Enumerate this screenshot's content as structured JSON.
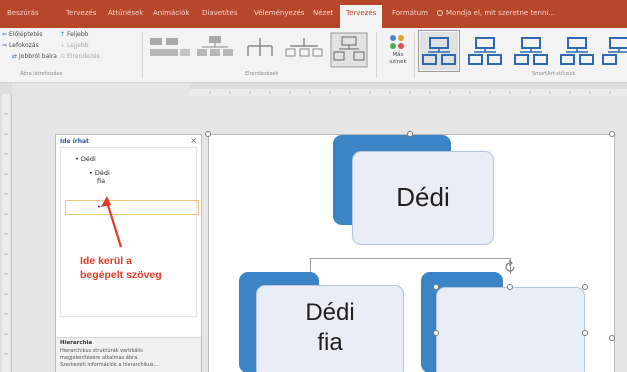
{
  "ribbon_tabs": [
    {
      "label": "Beszúrás"
    },
    {
      "label": "Tervezés"
    },
    {
      "label": "Áttűnések"
    },
    {
      "label": "Animációk"
    },
    {
      "label": "Diavetítés"
    },
    {
      "label": "Véleményezés"
    },
    {
      "label": "Nézet"
    },
    {
      "label": "Tervezés"
    },
    {
      "label": "Formátum"
    }
  ],
  "tell_me": "Mondja el, mit szeretne tenni...",
  "create_group": {
    "items": [
      {
        "label": "Előléptetés",
        "icon": "promote-icon"
      },
      {
        "label": "Lefokozás",
        "icon": "demote-icon"
      },
      {
        "label": "Jobbról balra",
        "icon": "right-to-left-icon"
      },
      {
        "label": "Feljebb",
        "icon": "move-up-icon"
      },
      {
        "label": "Lejjebb",
        "icon": "move-down-icon"
      },
      {
        "label": "Elrendezés",
        "icon": "layout-icon"
      }
    ],
    "label": "Ábra létrehozása"
  },
  "layouts_group": {
    "label": "Elrendezések"
  },
  "change_colors": {
    "line1": "Más",
    "line2": "színek"
  },
  "styles_group": {
    "label": "SmartArt-stílusok"
  },
  "text_pane": {
    "title": "Ide írhat",
    "close": "×",
    "bullets": [
      "Dédi",
      "Dédi",
      "fia",
      "•"
    ],
    "description_title": "Hierarchia",
    "description_lines": [
      "Hierarchikus struktúrák vertikális",
      "megjelenítésére alkalmas ábra.",
      "Szerkezeti információk a hierarchikus..."
    ]
  },
  "annotation": {
    "line1": "Ide kerül a",
    "line2": "begépelt szöveg"
  },
  "diagram": {
    "root": "Dédi",
    "child1_line1": "Dédi",
    "child1_line2": "fia",
    "child2": ""
  },
  "colors": {
    "accent": "#b7472a",
    "node_accent": "#3b84c6",
    "annotation": "#e33b2a"
  }
}
